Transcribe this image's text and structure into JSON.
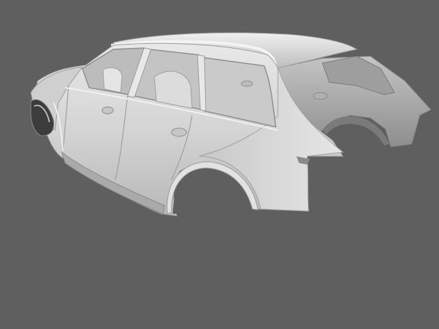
{
  "scene": {
    "subject": "car-body-shell-render",
    "background_color": "#5f5f5f",
    "body_color": "#d9d9d9"
  }
}
